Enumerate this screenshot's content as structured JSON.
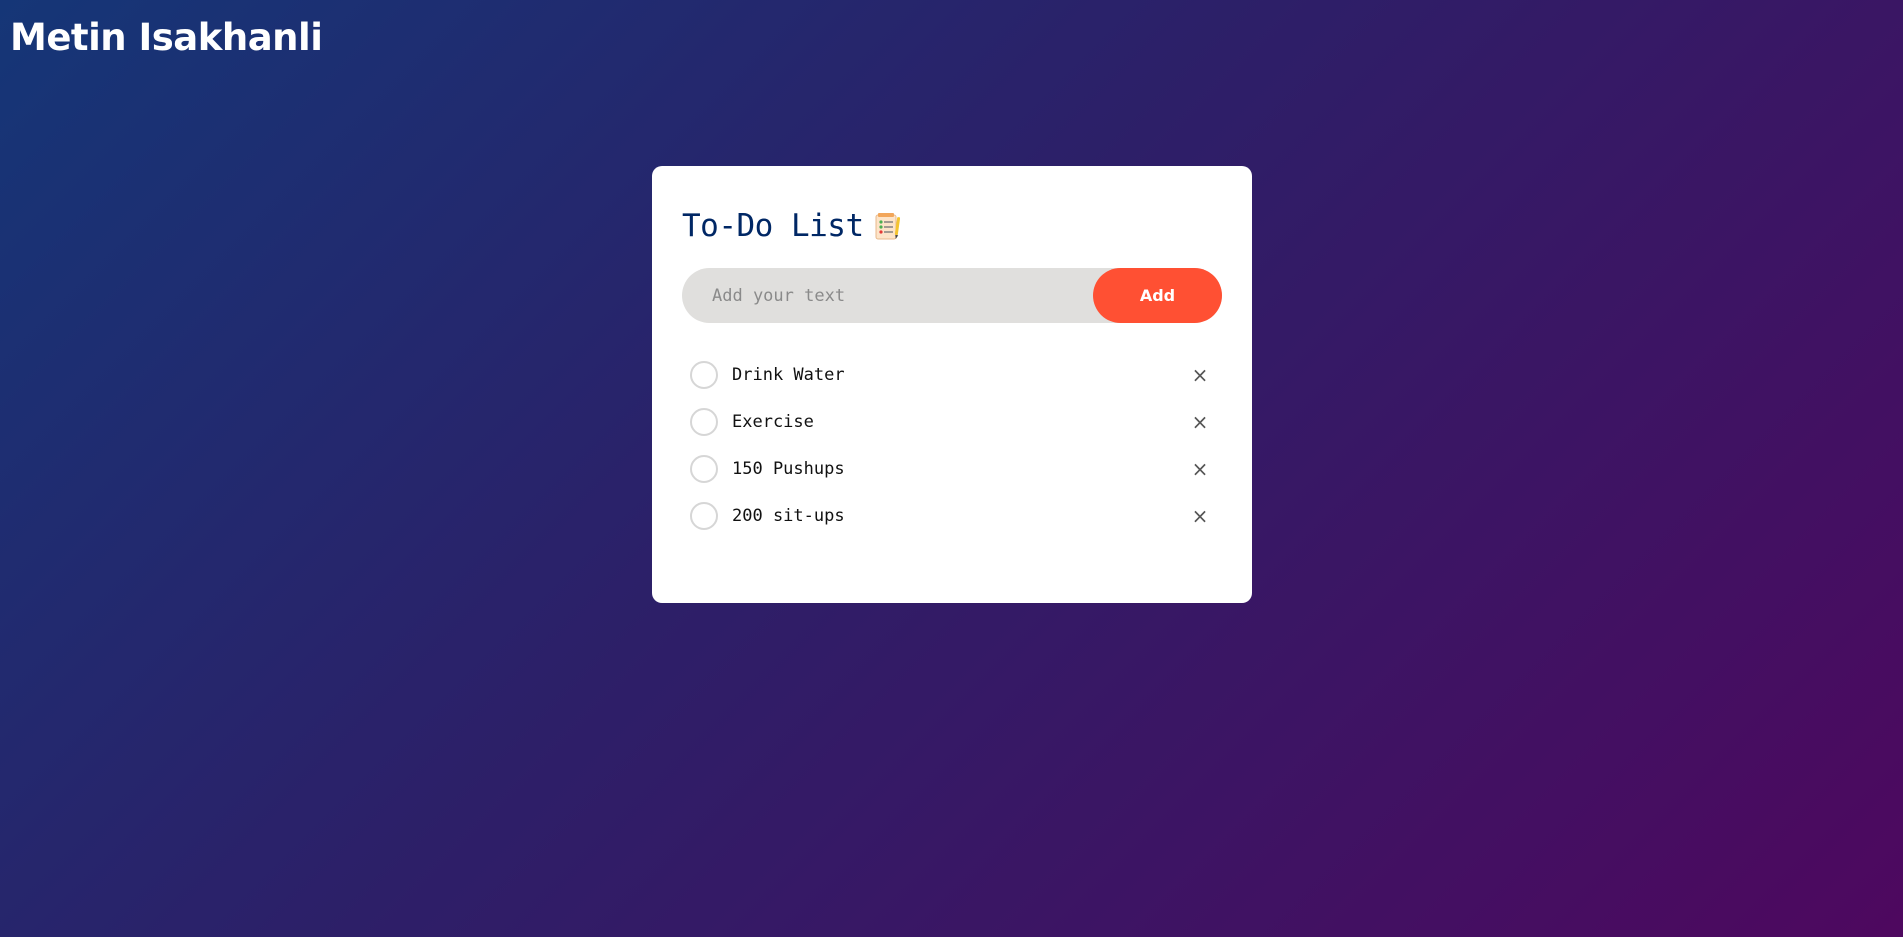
{
  "header": {
    "brand": "Metin Isakhanli"
  },
  "card": {
    "title": "To-Do List",
    "title_icon": "checklist-notepad-icon",
    "input": {
      "value": "",
      "placeholder": "Add your text"
    },
    "add_button_label": "Add",
    "items": [
      {
        "text": "Drink Water",
        "checked": false,
        "remove_glyph": "×"
      },
      {
        "text": "Exercise",
        "checked": false,
        "remove_glyph": "×"
      },
      {
        "text": "150 Pushups",
        "checked": false,
        "remove_glyph": "×"
      },
      {
        "text": "200 sit-ups",
        "checked": false,
        "remove_glyph": "×"
      }
    ]
  },
  "colors": {
    "gradient_start": "#153677",
    "gradient_end": "#4e085f",
    "title": "#002765",
    "accent": "#ff5033",
    "input_bg": "#e0dfdd"
  }
}
